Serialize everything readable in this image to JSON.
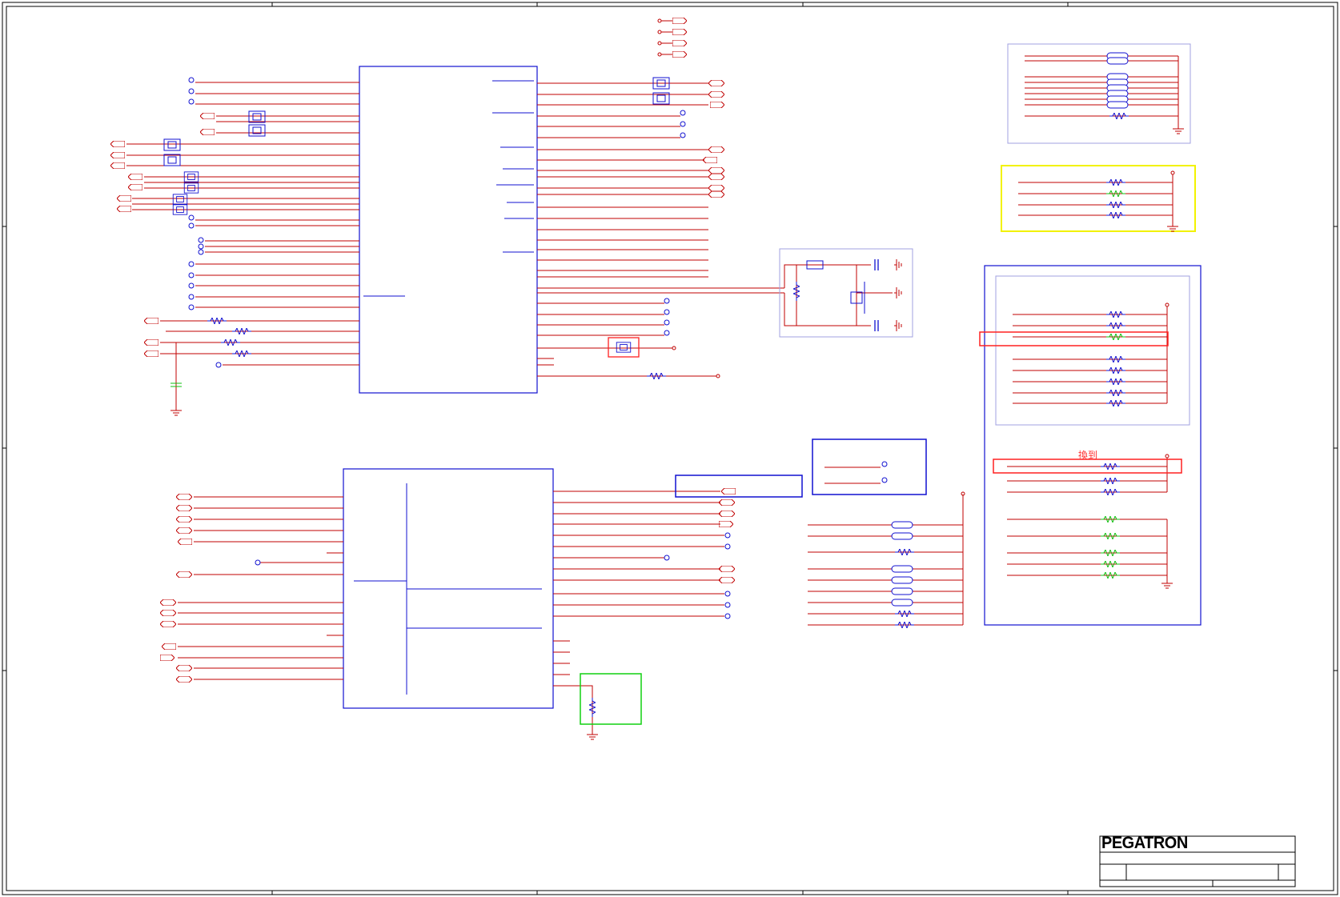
{
  "title_block": {
    "company_logo": "PEGATRON"
  },
  "annotations": {
    "note_red": "換到"
  },
  "colors": {
    "frame": "#000000",
    "wire": "#c00000",
    "component": "#1010d0",
    "highlight_red": "#ff2020",
    "highlight_yellow": "#f2f200",
    "highlight_green": "#10d010",
    "subgroup_border": "#a0a0e0"
  },
  "icons": {
    "resistor": "zigzag-resistor-icon",
    "capacitor": "capacitor-icon",
    "ground": "ground-symbol-icon",
    "offpage_connector": "offpage-connector-icon",
    "test_point": "test-point-icon",
    "crystal": "crystal-icon"
  }
}
